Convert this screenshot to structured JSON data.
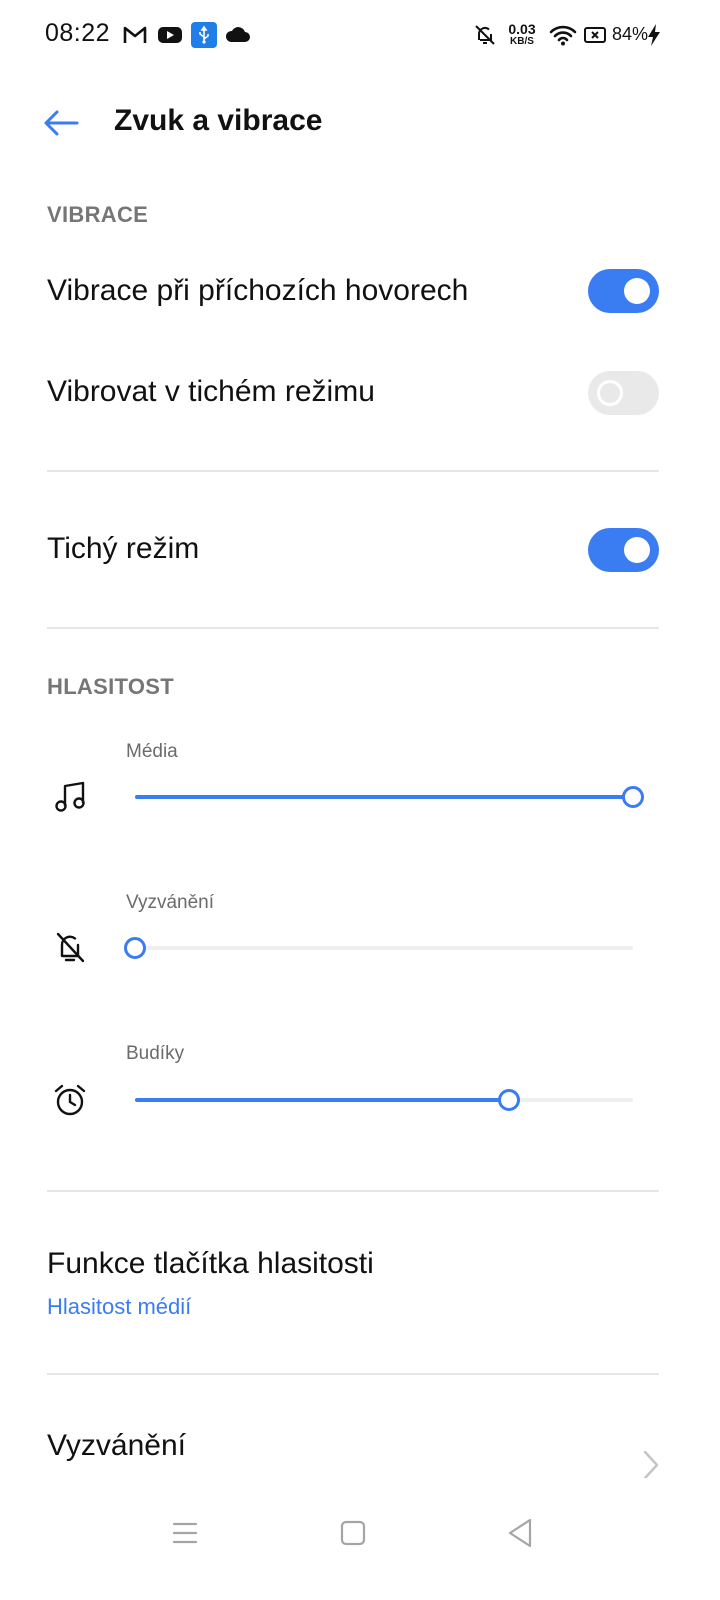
{
  "status_bar": {
    "time": "08:22",
    "left_icons": [
      "gmail-icon",
      "youtube-icon",
      "usb-icon",
      "cloud-icon"
    ],
    "right_icons": [
      "mute-bell-icon",
      "wifi-icon",
      "battery-saver-icon",
      "charging-icon"
    ],
    "net_speed_value": "0.03",
    "net_speed_unit": "KB/S",
    "battery": "84%"
  },
  "header": {
    "title": "Zvuk a vibrace"
  },
  "vibration": {
    "section_title": "VIBRACE",
    "items": [
      {
        "label": "Vibrace při příchozích hovorech",
        "enabled": true
      },
      {
        "label": "Vibrovat v tichém režimu",
        "enabled": false
      }
    ]
  },
  "silent_mode": {
    "label": "Tichý režim",
    "enabled": true
  },
  "volume": {
    "section_title": "HLASITOST",
    "sliders": [
      {
        "label": "Média",
        "icon": "music-note-icon",
        "level": 1.0
      },
      {
        "label": "Vyzvánění",
        "icon": "bell-off-icon",
        "level": 0.0
      },
      {
        "label": "Budíky",
        "icon": "alarm-clock-icon",
        "level": 0.75
      }
    ]
  },
  "volume_button": {
    "title": "Funkce tlačítka hlasitosti",
    "value": "Hlasitost médií"
  },
  "ringtone": {
    "title": "Vyzvánění"
  },
  "colors": {
    "accent": "#3a7cf2",
    "toggle_off": "#e9e9e9",
    "section_header": "#767676"
  }
}
